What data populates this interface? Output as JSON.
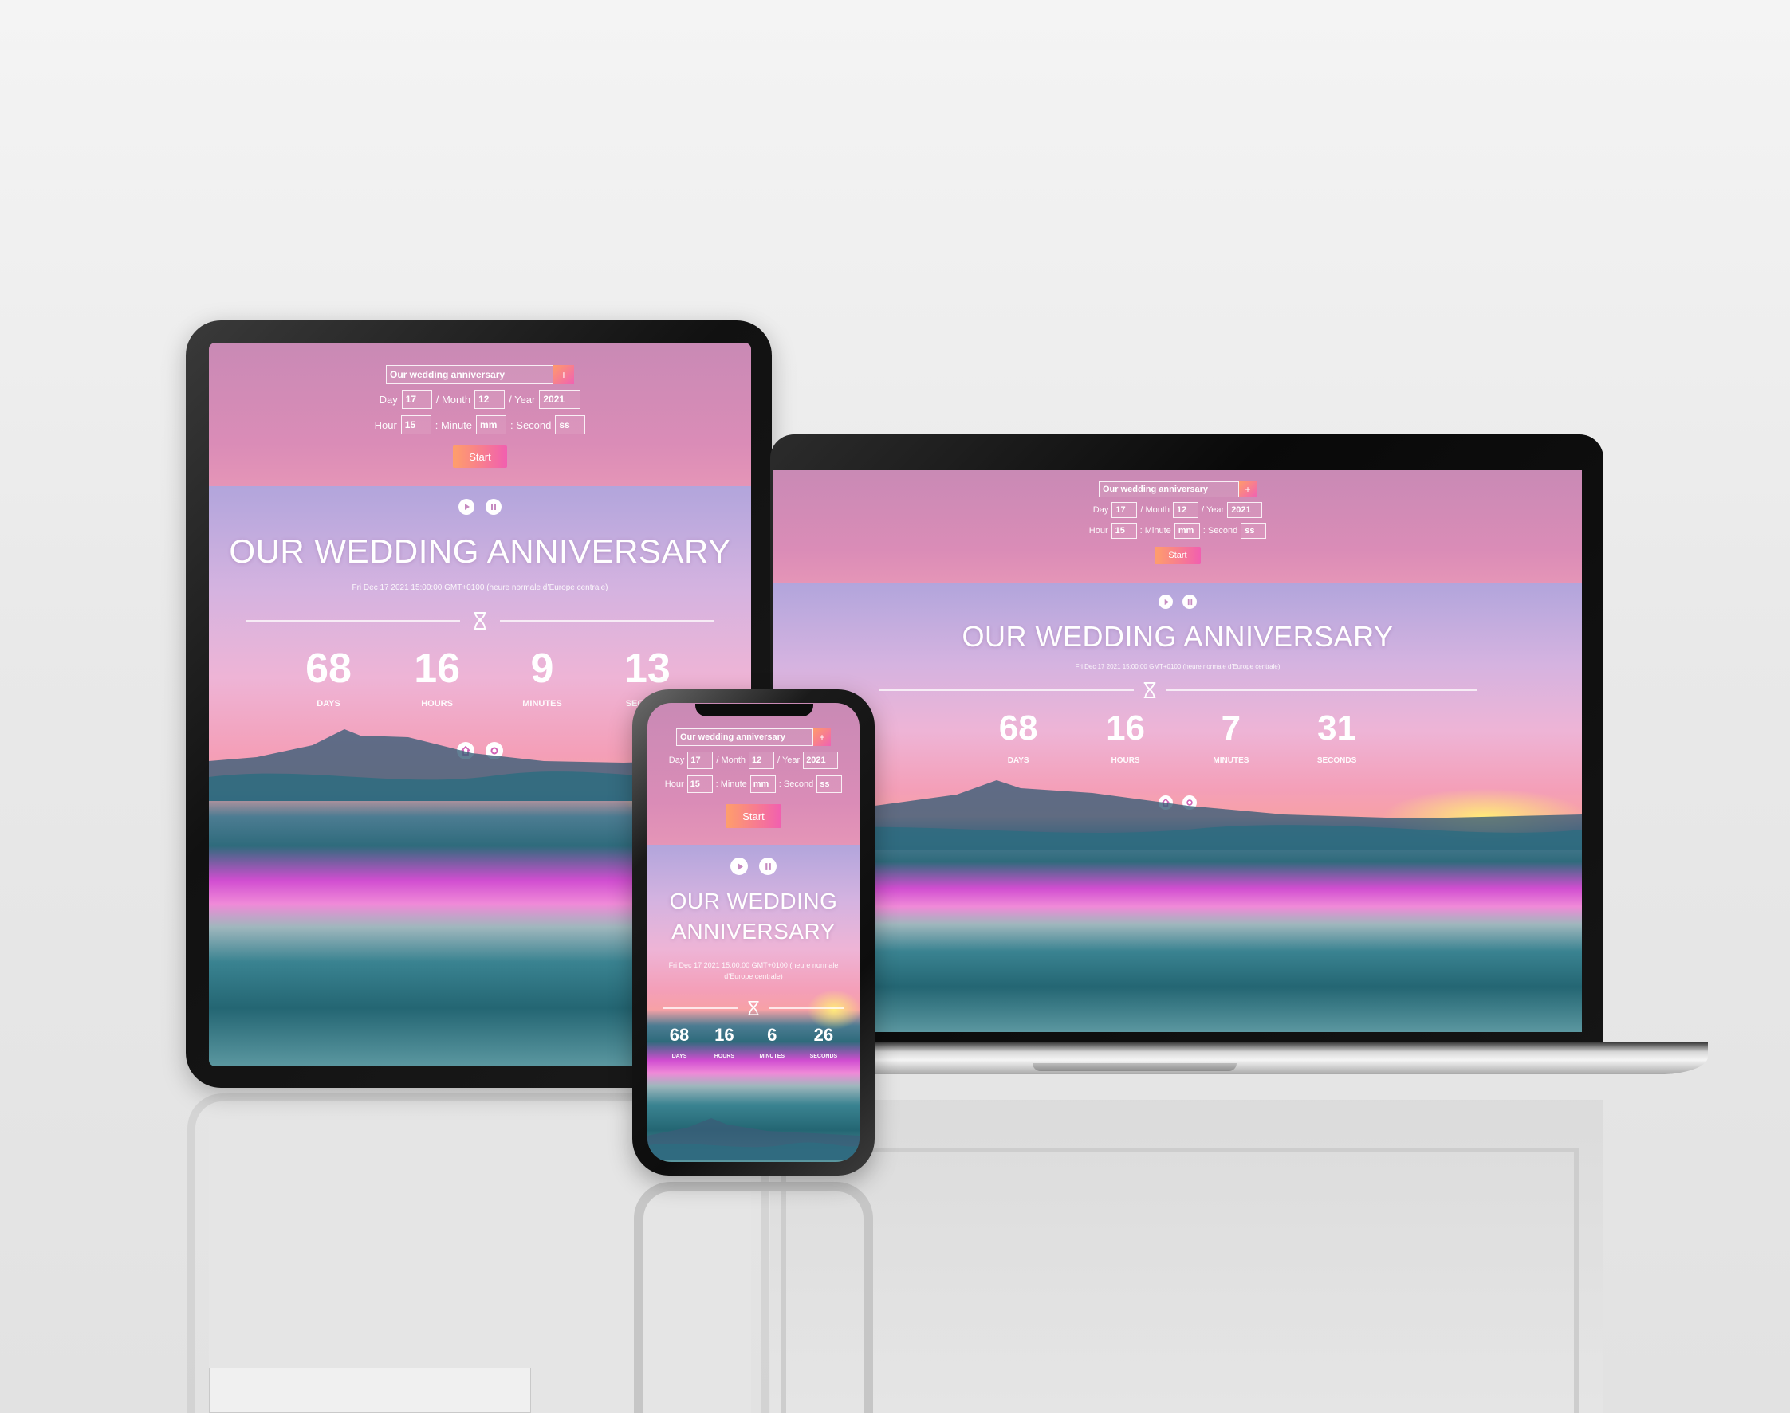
{
  "app": {
    "event_name_value": "Our wedding anniversary",
    "add_label": "+",
    "day_label": "Day",
    "day_value": "17",
    "month_label": "/ Month",
    "month_value": "12",
    "year_label": "/ Year",
    "year_value": "2021",
    "hour_label": "Hour",
    "hour_value": "15",
    "minute_label": ": Minute",
    "minute_placeholder": "mm",
    "second_label": ": Second",
    "second_placeholder": "ss",
    "start_label": "Start",
    "title": "OUR WEDDING ANNIVERSARY",
    "date_text": "Fri Dec 17 2021 15:00:00 GMT+0100 (heure normale d’Europe centrale)",
    "units": {
      "days": "DAYS",
      "hours": "HOURS",
      "minutes": "MINUTES",
      "seconds": "SECONDS"
    }
  },
  "tablet": {
    "days": "68",
    "hours": "16",
    "minutes": "9",
    "seconds": "13"
  },
  "laptop": {
    "days": "68",
    "hours": "16",
    "minutes": "7",
    "seconds": "31"
  },
  "phone": {
    "days": "68",
    "hours": "16",
    "minutes": "6",
    "seconds": "26"
  },
  "icons": [
    "play-icon",
    "pause-icon",
    "home-icon",
    "settings-icon",
    "hourglass-icon"
  ],
  "colors": {
    "start_button_from": "#ff9f6a",
    "start_button_to": "#f15fb0",
    "header_bg": "#d88bb6"
  }
}
